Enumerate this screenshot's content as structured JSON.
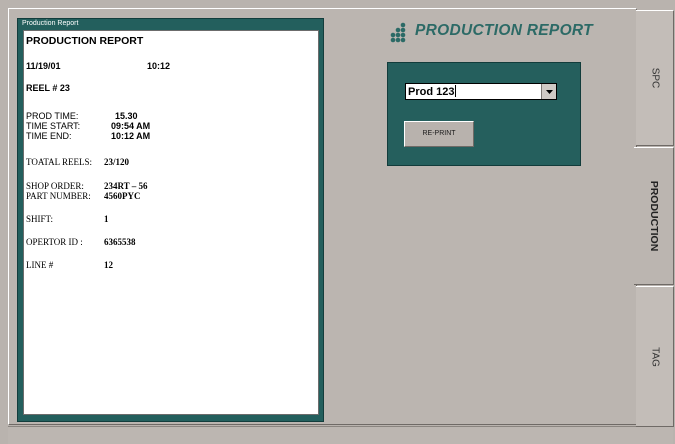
{
  "window": {
    "title": "Production Report"
  },
  "report": {
    "heading": "PRODUCTION REPORT",
    "date": "11/19/01",
    "time": "10:12",
    "reel": "REEL # 23",
    "prod_time_label": "PROD TIME:",
    "prod_time_value": "15.30",
    "time_start_label": "TIME START:",
    "time_start_value": "09:54 AM",
    "time_end_label": "TIME END:",
    "time_end_value": "10:12 AM",
    "total_reels_label": "TOATAL REELS:",
    "total_reels_value": "23/120",
    "shop_order_label": "SHOP ORDER:",
    "shop_order_value": "234RT – 56",
    "part_number_label": "PART NUMBER:",
    "part_number_value": "4560PYC",
    "shift_label": "SHIFT:",
    "shift_value": "1",
    "operator_label": "OPERTOR ID :",
    "operator_value": "6365538",
    "line_label": "LINE #",
    "line_value": "12"
  },
  "header": {
    "title": "PRODUCTION REPORT",
    "logo_icon": "dots-logo-icon"
  },
  "controls": {
    "product_select_value": "Prod 123",
    "reprint_label": "RE-PRINT"
  },
  "tabs": [
    {
      "label": "SPC",
      "active": false
    },
    {
      "label": "PRODUCTION",
      "active": true
    },
    {
      "label": "TAG",
      "active": false
    }
  ],
  "colors": {
    "teal_frame": "#235f5d",
    "panel_bg": "#bbb5b0",
    "title_teal": "#2c6a66"
  }
}
